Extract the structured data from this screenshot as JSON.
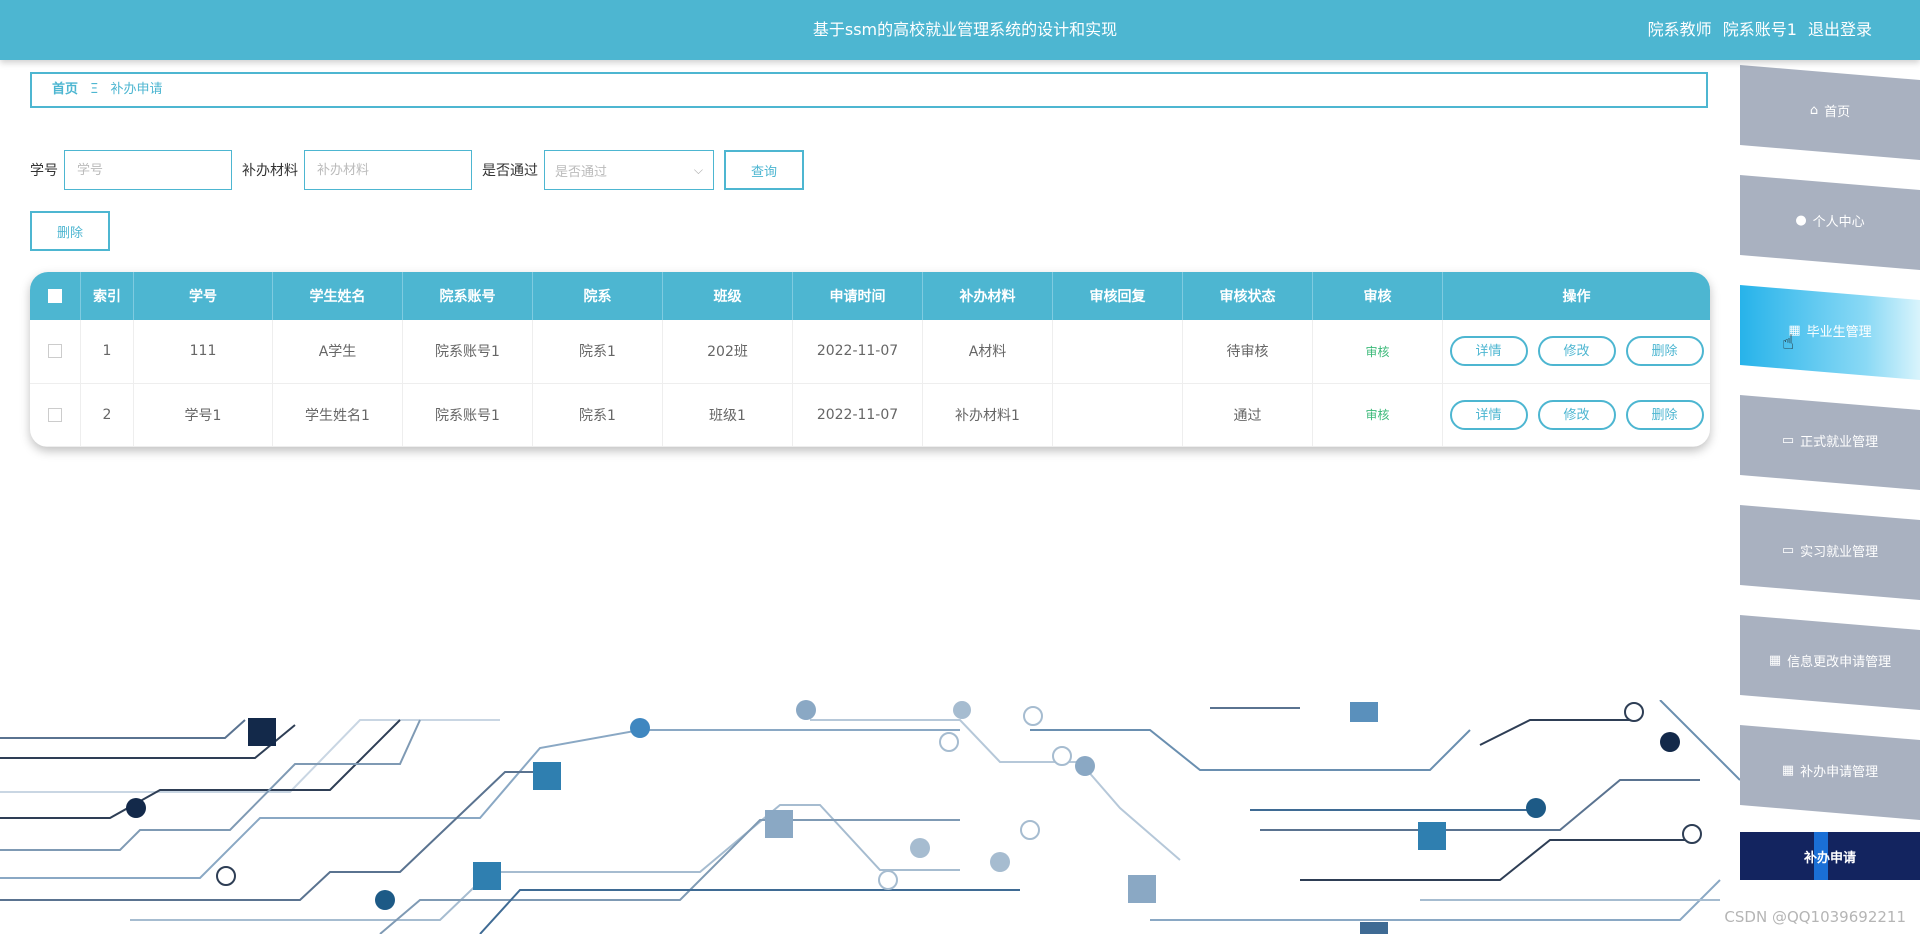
{
  "header": {
    "title": "基于ssm的高校就业管理系统的设计和实现",
    "role": "院系教师",
    "account": "院系账号1",
    "logout": "退出登录"
  },
  "breadcrumb": {
    "home": "首页",
    "separator": "Ξ",
    "current": "补办申请"
  },
  "search": {
    "student_no_label": "学号",
    "student_no_placeholder": "学号",
    "material_label": "补办材料",
    "material_placeholder": "补办材料",
    "passed_label": "是否通过",
    "passed_placeholder": "是否通过",
    "query_button": "查询"
  },
  "actions": {
    "delete_button": "删除"
  },
  "table": {
    "columns": [
      "索引",
      "学号",
      "学生姓名",
      "院系账号",
      "院系",
      "班级",
      "申请时间",
      "补办材料",
      "审核回复",
      "审核状态",
      "审核",
      "操作"
    ],
    "rows": [
      {
        "index": "1",
        "student_no": "111",
        "student_name": "A学生",
        "dept_account": "院系账号1",
        "dept": "院系1",
        "class": "202班",
        "apply_time": "2022-11-07",
        "material": "A材料",
        "reply": "",
        "status": "待审核",
        "audit": "审核"
      },
      {
        "index": "2",
        "student_no": "学号1",
        "student_name": "学生姓名1",
        "dept_account": "院系账号1",
        "dept": "院系1",
        "class": "班级1",
        "apply_time": "2022-11-07",
        "material": "补办材料1",
        "reply": "",
        "status": "通过",
        "audit": "审核"
      }
    ],
    "op_detail": "详情",
    "op_edit": "修改",
    "op_delete": "删除"
  },
  "sidebar": {
    "items": [
      {
        "label": "首页",
        "icon": "home-icon"
      },
      {
        "label": "个人中心",
        "icon": "user-icon"
      },
      {
        "label": "毕业生管理",
        "icon": "grid-icon"
      },
      {
        "label": "正式就业管理",
        "icon": "monitor-icon"
      },
      {
        "label": "实习就业管理",
        "icon": "monitor-icon"
      },
      {
        "label": "信息更改申请管理",
        "icon": "grid-icon"
      },
      {
        "label": "补办申请管理",
        "icon": "grid-icon"
      }
    ],
    "sub_item": "补办申请"
  },
  "watermark": "CSDN @QQ1039692211",
  "colors": {
    "primary": "#4db6d1",
    "sidebar_item": "#a9b1c0",
    "sidebar_active": "#27b3ea",
    "sub_item_bg": "#13245f",
    "audit_text": "#3dba7a"
  }
}
